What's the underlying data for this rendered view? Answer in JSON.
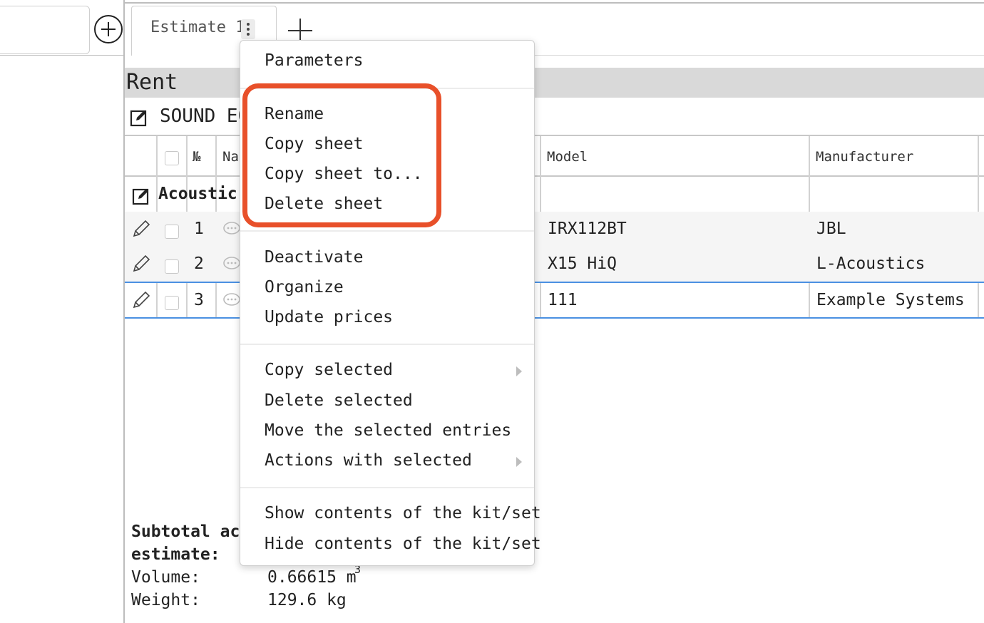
{
  "tabs": {
    "active_label": "Estimate 1"
  },
  "section": {
    "title": "Rent",
    "subsection_title": "SOUND EQ"
  },
  "table": {
    "headers": {
      "number": "№",
      "name": "Nar",
      "model": "Model",
      "manufacturer": "Manufacturer"
    },
    "group_title": "Acoustic s",
    "rows": [
      {
        "num": "1",
        "model": "IRX112BT",
        "manufacturer": "JBL"
      },
      {
        "num": "2",
        "model": "X15 HiQ",
        "manufacturer": "L-Acoustics"
      },
      {
        "num": "3",
        "model": "111",
        "manufacturer": "Example Systems"
      }
    ]
  },
  "footer": {
    "subtotal_line1": "Subtotal acc",
    "subtotal_line2": "estimate:",
    "volume_label": "Volume:",
    "volume_value": "0.66615 m",
    "volume_sup": "3",
    "weight_label": "Weight:",
    "weight_value": "129.6 kg"
  },
  "context_menu": {
    "items": [
      "Parameters",
      "Rename",
      "Copy sheet",
      "Copy sheet to...",
      "Delete sheet",
      "Deactivate",
      "Organize",
      "Update prices",
      "Copy selected",
      "Delete selected",
      "Move the selected entries",
      "Actions with selected",
      "Show contents of the kit/set",
      "Hide contents of the kit/set"
    ]
  },
  "colors": {
    "highlight": "#e8502a",
    "selection": "#4a90e2",
    "band": "#d9d9d9"
  },
  "icons": [
    "plus-circle-icon",
    "kebab-icon",
    "plus-icon",
    "edit-square-icon",
    "pencil-icon",
    "comment-icon",
    "submenu-arrow-icon"
  ]
}
